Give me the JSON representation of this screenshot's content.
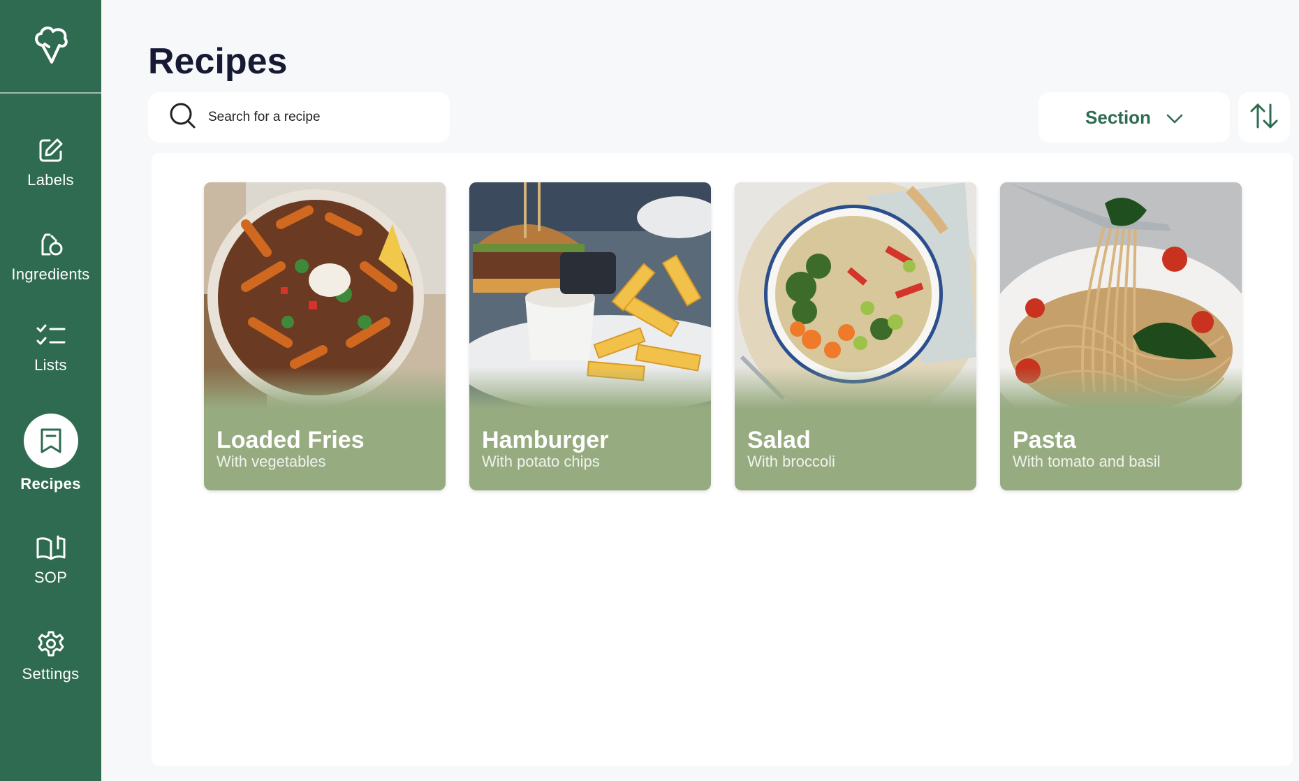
{
  "page": {
    "title": "Recipes"
  },
  "search": {
    "placeholder": "Search for a recipe"
  },
  "toolbar": {
    "section_label": "Section"
  },
  "sidebar": {
    "items": [
      {
        "label": "Labels",
        "icon": "edit-icon"
      },
      {
        "label": "Ingredients",
        "icon": "ingredients-icon"
      },
      {
        "label": "Lists",
        "icon": "checklist-icon"
      },
      {
        "label": "Recipes",
        "icon": "bookmark-icon",
        "active": true
      },
      {
        "label": "SOP",
        "icon": "book-icon"
      },
      {
        "label": "Settings",
        "icon": "gear-icon"
      }
    ]
  },
  "recipes": [
    {
      "title": "Loaded Fries",
      "subtitle": "With vegetables"
    },
    {
      "title": "Hamburger",
      "subtitle": "With potato chips"
    },
    {
      "title": "Salad",
      "subtitle": "With broccoli"
    },
    {
      "title": "Pasta",
      "subtitle": "With tomato and basil"
    }
  ],
  "colors": {
    "sidebar": "#2e6b50",
    "card": "#97ab80",
    "title": "#161a33",
    "background": "#f7f8fa"
  }
}
